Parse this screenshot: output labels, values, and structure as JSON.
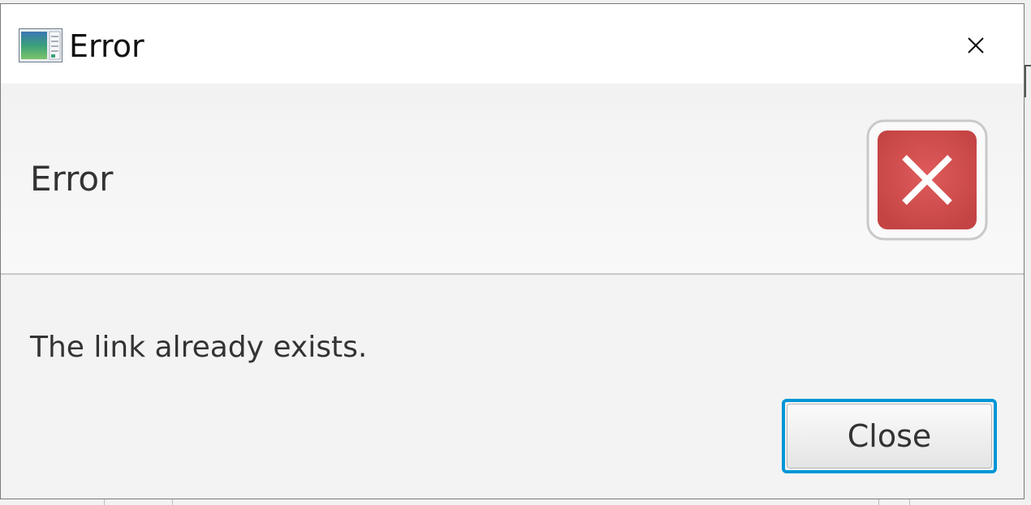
{
  "window": {
    "title": "Error",
    "app_icon": "app-window-icon",
    "close_icon": "close-icon"
  },
  "header": {
    "text": "Error",
    "graphic_icon": "error-icon",
    "graphic_color": "#d24b4b"
  },
  "content": {
    "message": "The link already exists."
  },
  "buttons": {
    "close_label": "Close"
  },
  "colors": {
    "focus_ring": "#0096d6",
    "dialog_background": "#f3f3f3"
  }
}
